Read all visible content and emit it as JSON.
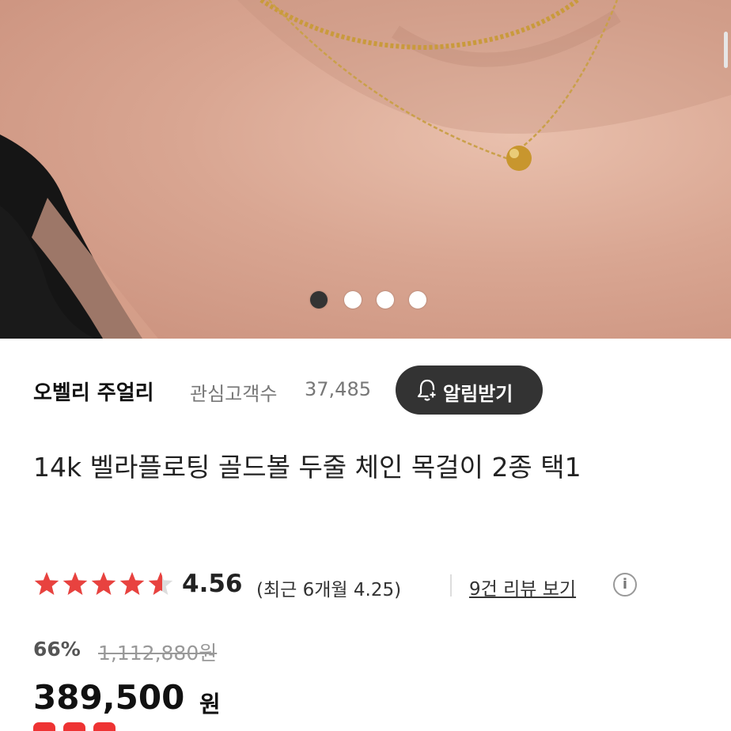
{
  "carousel": {
    "total": 4,
    "active_index": 0
  },
  "seller": {
    "name": "오벨리 주얼리",
    "followers_label": "관심고객수",
    "followers_count": "37,485",
    "alarm_button_label": "알림받기",
    "alarm_icon": "bell-plus-icon"
  },
  "product": {
    "title": "14k 벨라플로팅 골드볼 두줄 체인 목걸이 2종 택1"
  },
  "rating": {
    "stars": 4.56,
    "value": "4.56",
    "recent": "(최근 6개월 4.25)",
    "review_link": "9건 리뷰 보기",
    "info_icon": "info-icon",
    "star_color": "#e8423f"
  },
  "price": {
    "discount_rate": "66%",
    "original": "1,112,880원",
    "sale": "389,500",
    "currency": "원"
  }
}
